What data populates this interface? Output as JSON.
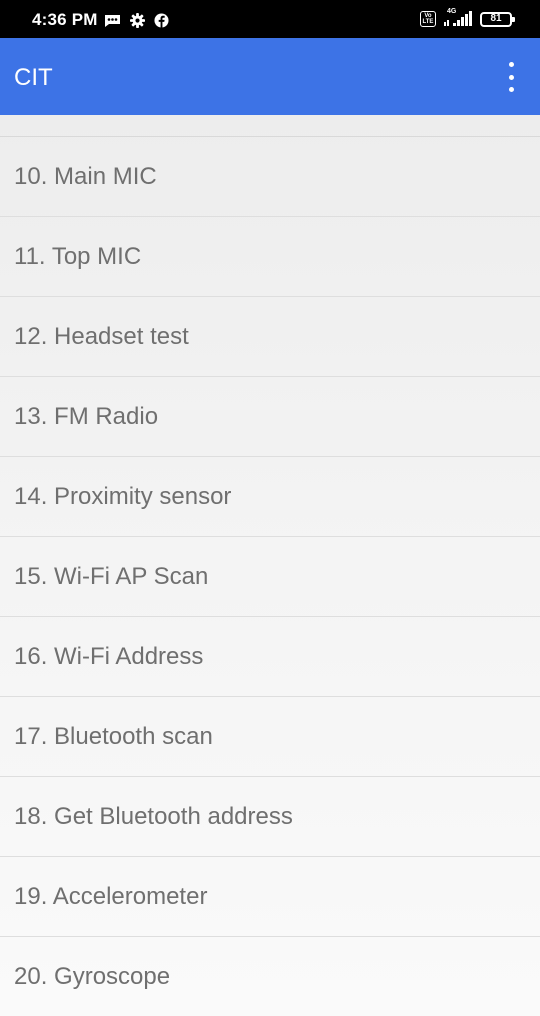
{
  "status_bar": {
    "time": "4:36 PM",
    "left_icons": [
      "message-icon",
      "gear-icon",
      "facebook-icon"
    ],
    "right_icons": [
      "volte-icon",
      "signal-4g-icon",
      "battery-icon"
    ],
    "volte_label_top": "Vo",
    "volte_label_bottom": "LTE",
    "network_label": "4G",
    "battery_level": "81"
  },
  "app_bar": {
    "title": "CIT",
    "menu_icon": "more-vert-icon",
    "accent_color": "#3d73e6"
  },
  "list": {
    "items": [
      {
        "label": "10. Main MIC"
      },
      {
        "label": "11. Top MIC"
      },
      {
        "label": "12. Headset test"
      },
      {
        "label": "13. FM Radio"
      },
      {
        "label": "14. Proximity sensor"
      },
      {
        "label": "15. Wi-Fi AP Scan"
      },
      {
        "label": "16. Wi-Fi Address"
      },
      {
        "label": "17. Bluetooth scan"
      },
      {
        "label": "18. Get Bluetooth address"
      },
      {
        "label": "19. Accelerometer"
      },
      {
        "label": "20. Gyroscope"
      }
    ]
  }
}
